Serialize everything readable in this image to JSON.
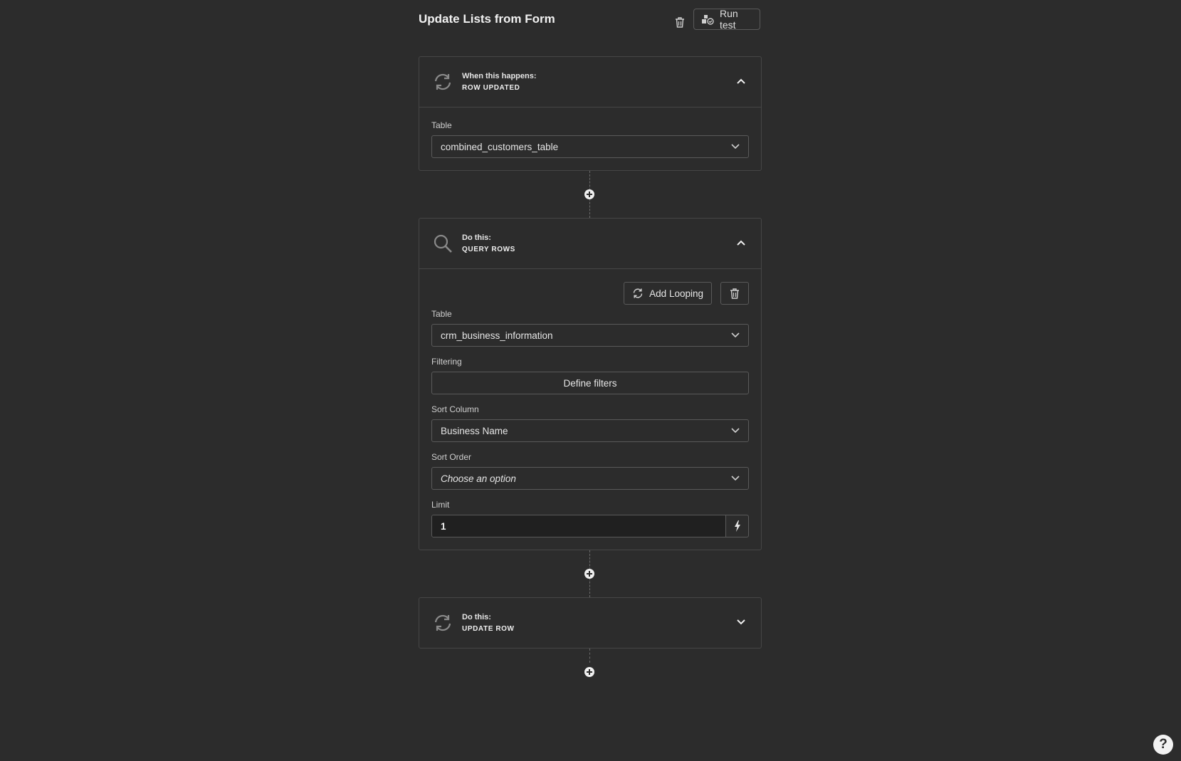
{
  "header": {
    "title": "Update Lists from Form",
    "run_test_label": "Run test"
  },
  "trigger": {
    "caption": "When this happens:",
    "name": "ROW UPDATED",
    "table_label": "Table",
    "table_value": "combined_customers_table"
  },
  "query_step": {
    "caption": "Do this:",
    "name": "QUERY ROWS",
    "add_looping_label": "Add Looping",
    "table_label": "Table",
    "table_value": "crm_business_information",
    "filtering_label": "Filtering",
    "define_filters_label": "Define filters",
    "sort_column_label": "Sort Column",
    "sort_column_value": "Business Name",
    "sort_order_label": "Sort Order",
    "sort_order_placeholder": "Choose an option",
    "limit_label": "Limit",
    "limit_value": "1"
  },
  "update_step": {
    "caption": "Do this:",
    "name": "UPDATE ROW"
  },
  "help_label": "?",
  "icons": {
    "trash": "trash-icon",
    "run_test": "run-test-icon",
    "refresh": "refresh-icon",
    "search": "search-icon",
    "chevron_up": "chevron-up-icon",
    "chevron_down": "chevron-down-icon",
    "add": "add-step-icon",
    "loop": "loop-icon",
    "lightning": "lightning-icon",
    "help": "help-icon"
  }
}
